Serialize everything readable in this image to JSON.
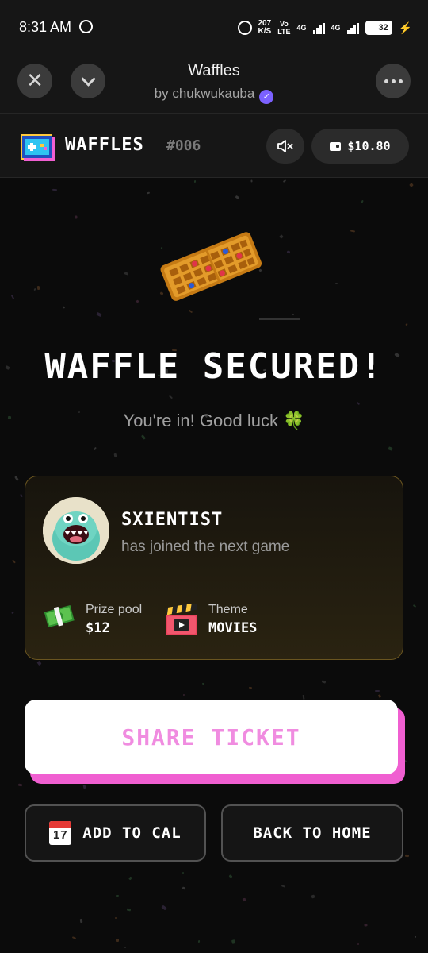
{
  "status_bar": {
    "time": "8:31 AM",
    "speed_value": "207",
    "speed_unit": "K/S",
    "volte_top": "Vo",
    "volte_bottom": "LTE",
    "net1": "4G",
    "net2": "4G",
    "battery": "32"
  },
  "app_bar": {
    "title": "Waffles",
    "subtitle": "by chukwukauba"
  },
  "header": {
    "brand": "WAFFLES",
    "game_number": "#006",
    "balance": "$10.80"
  },
  "main": {
    "headline": "WAFFLE SECURED!",
    "subline": "You're in! Good luck 🍀"
  },
  "card": {
    "username": "SXIENTIST",
    "joined_text": "has joined the next game",
    "prize_label": "Prize pool",
    "prize_value": "$12",
    "theme_label": "Theme",
    "theme_value": "MOVIES"
  },
  "buttons": {
    "share": "SHARE TICKET",
    "calendar": "ADD TO CAL",
    "home": "BACK TO HOME",
    "calendar_day": "17"
  },
  "colors": {
    "share_accent": "#f05fd1",
    "share_text": "#f08ce0",
    "card_border": "#6a5520",
    "verified": "#7b61ff"
  },
  "icons": [
    "close-icon",
    "chevron-down-icon",
    "more-icon",
    "waffles-logo",
    "mute-icon",
    "wallet-icon",
    "waffle-image",
    "avatar",
    "money-icon",
    "clapperboard-icon",
    "calendar-icon"
  ]
}
